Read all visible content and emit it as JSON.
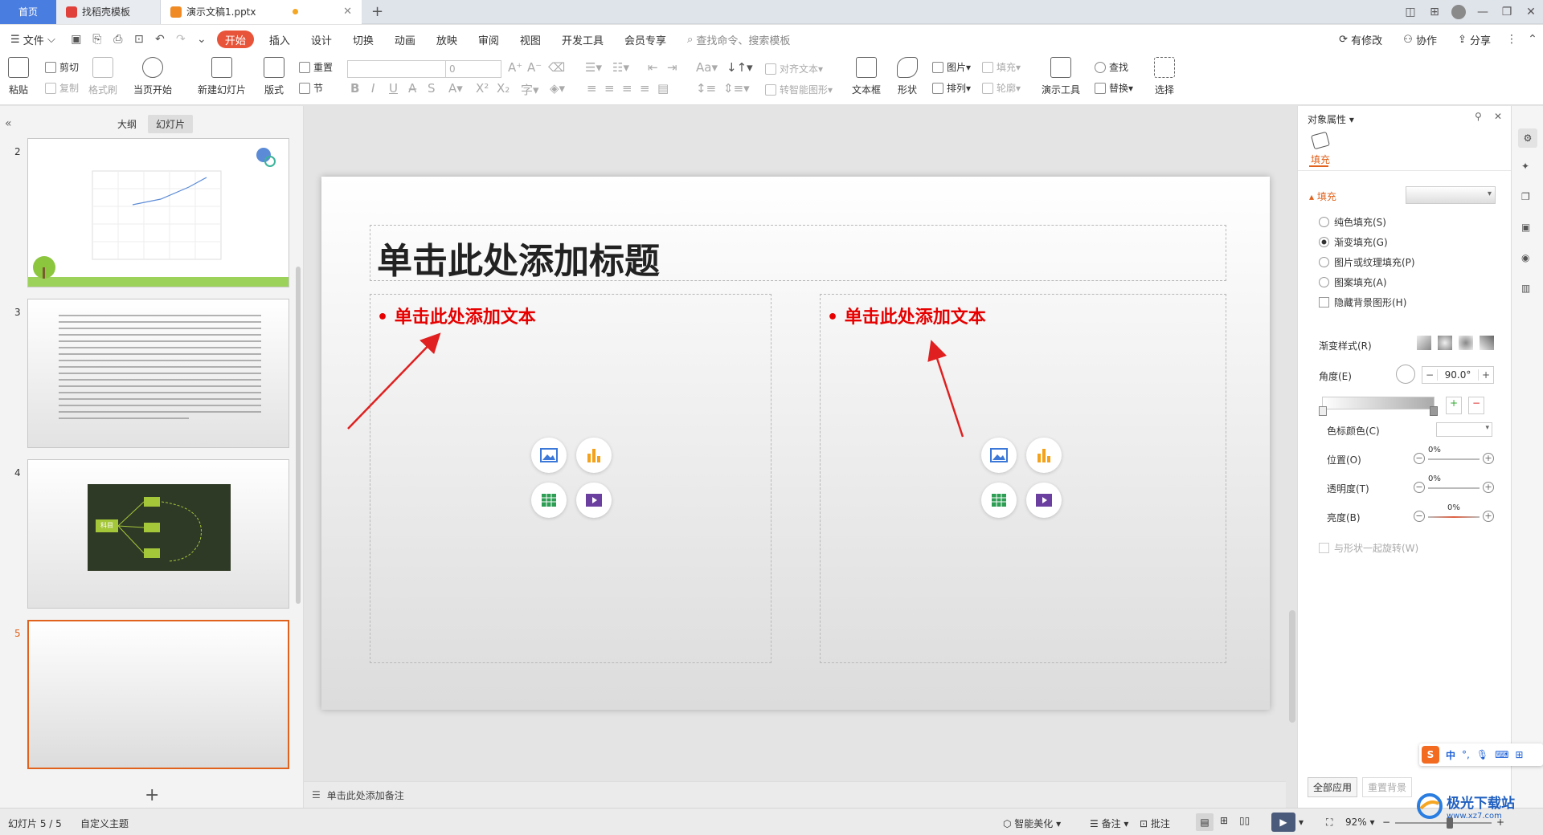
{
  "tabs": {
    "home": "首页",
    "templates": "找稻壳模板",
    "document": "演示文稿1.pptx",
    "new_tab": "+"
  },
  "menu": {
    "file": "文件",
    "items": [
      "开始",
      "插入",
      "设计",
      "切换",
      "动画",
      "放映",
      "审阅",
      "视图",
      "开发工具",
      "会员专享"
    ],
    "search_placeholder": "查找命令、搜索模板",
    "has_changes": "有修改",
    "collaborate": "协作",
    "share": "分享"
  },
  "ribbon": {
    "paste": "粘贴",
    "cut": "剪切",
    "copy": "复制",
    "format_painter": "格式刷",
    "from_start": "当页开始",
    "new_slide": "新建幻灯片",
    "layout": "版式",
    "reset": "重置",
    "section": "节",
    "font_size": "0",
    "align_text": "对齐文本",
    "smart_art": "转智能图形",
    "textbox": "文本框",
    "shape": "形状",
    "picture": "图片",
    "arrange": "排列",
    "fill": "填充",
    "outline": "轮廓",
    "presenter_tools": "演示工具",
    "find": "查找",
    "replace": "替换",
    "select": "选择"
  },
  "left_panel": {
    "outline_tab": "大纲",
    "slides_tab": "幻灯片",
    "slide_numbers": [
      "2",
      "3",
      "4",
      "5"
    ],
    "add_slide": "+",
    "thumb4_center": "科目"
  },
  "slide": {
    "title_placeholder": "单击此处添加标题",
    "left_text_placeholder": "单击此处添加文本",
    "right_text_placeholder": "单击此处添加文本",
    "accent_color": "#e60000"
  },
  "notes_placeholder": "单击此处添加备注",
  "right_panel": {
    "header": "对象属性",
    "fill_tab": "填充",
    "fill_section": "填充",
    "solid_fill": "纯色填充(S)",
    "gradient_fill": "渐变填充(G)",
    "picture_fill": "图片或纹理填充(P)",
    "pattern_fill": "图案填充(A)",
    "hide_bg": "隐藏背景图形(H)",
    "gradient_style": "渐变样式(R)",
    "angle_label": "角度(E)",
    "angle_value": "90.0°",
    "stop_color": "色标颜色(C)",
    "position": "位置(O)",
    "position_value": "0%",
    "transparency": "透明度(T)",
    "transparency_value": "0%",
    "brightness": "亮度(B)",
    "brightness_value": "0%",
    "rotate_with_shape": "与形状一起旋转(W)",
    "apply_all": "全部应用",
    "reset_bg": "重置背景"
  },
  "status": {
    "slide_info": "幻灯片 5 / 5",
    "theme": "自定义主题",
    "beautify": "智能美化",
    "notes": "备注",
    "comments": "批注",
    "zoom": "92%"
  },
  "ime": {
    "lang": "中",
    "punct": "°,"
  },
  "watermark": {
    "name": "极光下载站",
    "url": "www.xz7.com"
  }
}
